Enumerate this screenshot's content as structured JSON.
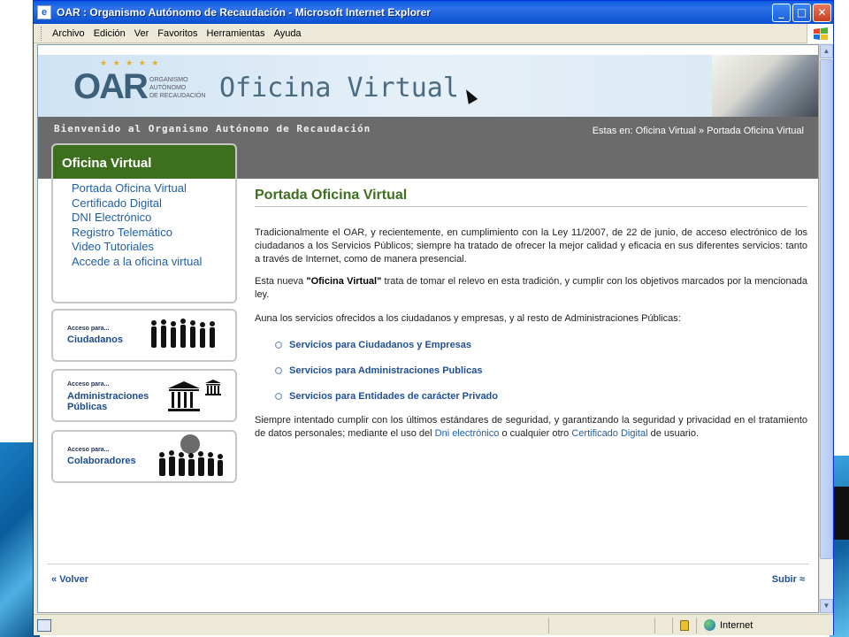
{
  "window": {
    "title": "OAR : Organismo Autónomo de Recaudación - Microsoft Internet Explorer",
    "minimize": "_",
    "maximize": "□",
    "close": "✕"
  },
  "menu": [
    "Archivo",
    "Edición",
    "Ver",
    "Favoritos",
    "Herramientas",
    "Ayuda"
  ],
  "header": {
    "logo_text": "OAR",
    "logo_stars": "★ ★ ★ ★ ★",
    "org_line1": "ORGANISMO",
    "org_line2": "AUTÓNOMO",
    "org_line3": "DE RECAUDACIÓN",
    "site_title": "Oficina Virtual"
  },
  "bar": {
    "welcome": "Bienvenido al Organismo Autónomo de Recaudación",
    "breadcrumb": "Estas en: Oficina Virtual » Portada Oficina Virtual"
  },
  "sidebar": {
    "heading": "Oficina Virtual",
    "links": [
      "Portada Oficina Virtual",
      "Certificado Digital",
      "DNI Electrónico",
      "Registro Telemático",
      "Video Tutoriales",
      "Accede a la oficina virtual"
    ]
  },
  "access_boxes": [
    {
      "small": "Acceso para...",
      "big_line1": "Ciudadanos",
      "big_line2": ""
    },
    {
      "small": "Acceso para...",
      "big_line1": "Administraciones",
      "big_line2": "Públicas"
    },
    {
      "small": "Acceso para...",
      "big_line1": "Colaboradores",
      "big_line2": ""
    }
  ],
  "content": {
    "title": "Portada Oficina Virtual",
    "p1": "Tradicionalmente el OAR, y recientemente, en cumplimiento con la Ley 11/2007, de 22 de junio, de acceso electrónico de los ciudadanos a los Servicios Públicos; siempre ha tratado de ofrecer la mejor calidad y eficacia en sus diferentes servicios: tanto a través de Internet, como de manera presencial.",
    "p2_pre": "Esta nueva ",
    "p2_bold": "\"Oficina Virtual\"",
    "p2_post": " trata de tomar el relevo en esta tradición, y cumplir con los objetivos marcados por la mencionada ley.",
    "p3": "Auna los servicios ofrecidos a los ciudadanos y empresas,  y al resto de Administraciones Públicas:",
    "services": [
      "Servicios para Ciudadanos y Empresas",
      "Servicios para Administraciones Publicas",
      "Servicios para Entidades de carácter Privado"
    ],
    "p4_pre": "Siempre intentado cumplir con los últimos estándares de seguridad, y garantizando la seguridad y privacidad en el tratamiento de datos personales; mediante el uso del ",
    "p4_link1": "Dni electrónico",
    "p4_mid": " o cualquier otro ",
    "p4_link2": "Certificado Digital",
    "p4_post": " de usuario."
  },
  "footer": {
    "back": "« Volver",
    "top": "Subir ≈"
  },
  "status": {
    "zone": "Internet"
  }
}
